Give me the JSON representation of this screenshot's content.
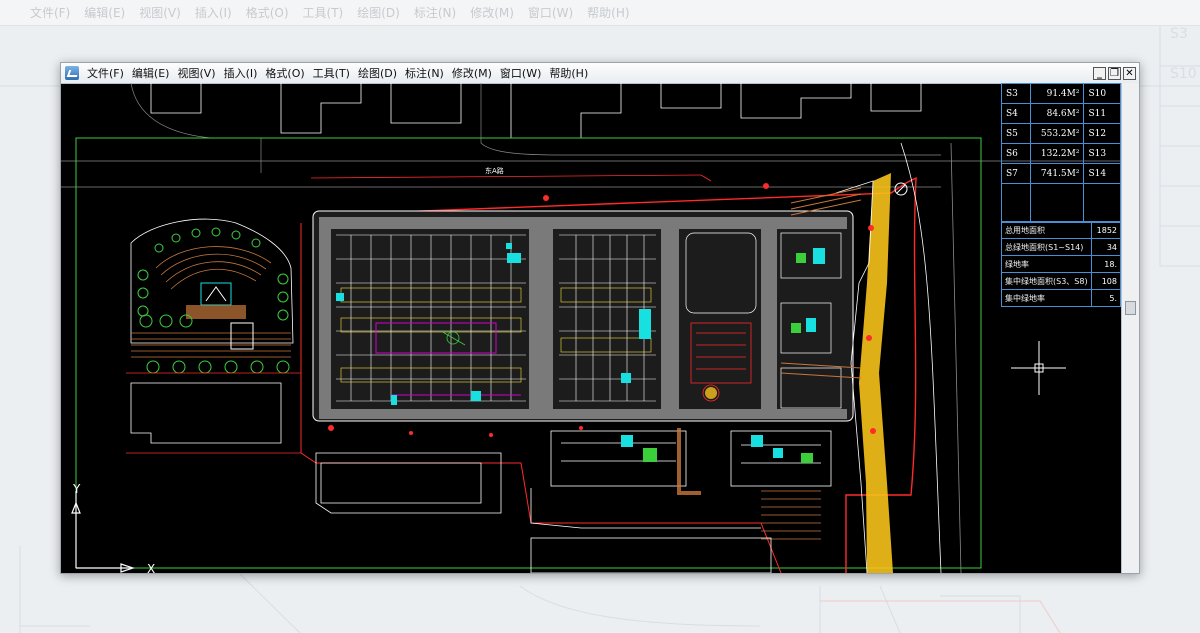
{
  "menu": {
    "items": [
      "文件(F)",
      "编辑(E)",
      "视图(V)",
      "插入(I)",
      "格式(O)",
      "工具(T)",
      "绘图(D)",
      "标注(N)",
      "修改(M)",
      "窗口(W)",
      "帮助(H)"
    ]
  },
  "window_controls": {
    "minimize": "_",
    "restore": "❐",
    "close": "✕"
  },
  "area_table": {
    "rows": [
      {
        "id": "S3",
        "area": "91.4M²",
        "next": "S10"
      },
      {
        "id": "S4",
        "area": "84.6M²",
        "next": "S11"
      },
      {
        "id": "S5",
        "area": "553.2M²",
        "next": "S12"
      },
      {
        "id": "S6",
        "area": "132.2M²",
        "next": "S13"
      },
      {
        "id": "S7",
        "area": "741.5M²",
        "next": "S14"
      }
    ]
  },
  "summary_table": {
    "rows": [
      {
        "label": "总用地面积",
        "value": "1852"
      },
      {
        "label": "总绿地面积(S1~S14)",
        "value": "34"
      },
      {
        "label": "绿地率",
        "value": "18."
      },
      {
        "label": "集中绿地面积(S3、S8)",
        "value": "108"
      },
      {
        "label": "集中绿地率",
        "value": "5."
      }
    ]
  },
  "drawing": {
    "road_label": "东A路",
    "ucs_x": "X",
    "ucs_y": "Y"
  },
  "colors": {
    "background": "#000000",
    "site_boundary": "#ff2a2a",
    "building_outline": "#ffffff",
    "green_line": "#3ccf3c",
    "cyan": "#19e0e0",
    "yellow_zone": "#f7c21a",
    "magenta": "#d000d0"
  }
}
